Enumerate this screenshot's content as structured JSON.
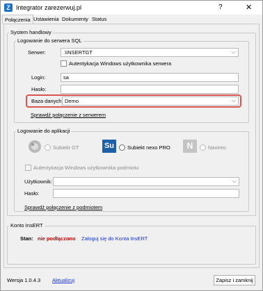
{
  "window": {
    "title": "Integrator zarezerwuj.pl",
    "help": "?",
    "close": "✕",
    "icon_letter": "Z"
  },
  "tabs": [
    {
      "label": "Połączenia"
    },
    {
      "label": "Ustawienia"
    },
    {
      "label": "Dokumenty"
    },
    {
      "label": "Status"
    }
  ],
  "system": {
    "title": "System handlowy",
    "sql_group": {
      "title": "Logowanie do serwera SQL",
      "server_label": "Serwer:",
      "server_value": ".\\INSERTGT",
      "windows_auth_label": "Autentykacja Windows użytkownika serwera",
      "login_label": "Login:",
      "login_value": "sa",
      "password_label": "Hasło:",
      "password_value": "",
      "database_label": "Baza danych:",
      "database_value": "Demo",
      "check_link": "Sprawdź połączenie z serwerem"
    },
    "app_group": {
      "title": "Logowanie do aplikacji",
      "options": [
        {
          "label": "Subiekt GT",
          "icon": "subiekt-gt-icon"
        },
        {
          "label": "Subiekt nexo PRO",
          "icon": "subiekt-nexo-icon",
          "icon_text": "Su"
        },
        {
          "label": "Navireo",
          "icon": "navireo-icon",
          "icon_text": "N"
        }
      ],
      "windows_auth_label": "Autentykacja Windows użytkownika podmiotu",
      "user_label": "Użytkownik:",
      "user_value": "",
      "password_label": "Hasło:",
      "password_value": "",
      "check_link": "Sprawdź połączenie z podmiotem"
    }
  },
  "konto": {
    "title": "Konto InsERT",
    "status_label": "Stan:",
    "status_value": "nie podłączono",
    "login_link": "Zaloguj się do Konta InsERT",
    "colors": {
      "status": "#cc0000",
      "link": "#1a33cc"
    }
  },
  "footer": {
    "version": "Wersja 1.0.4.3",
    "update_link": "Aktualizuj",
    "save_button": "Zapisz i zamknij"
  }
}
